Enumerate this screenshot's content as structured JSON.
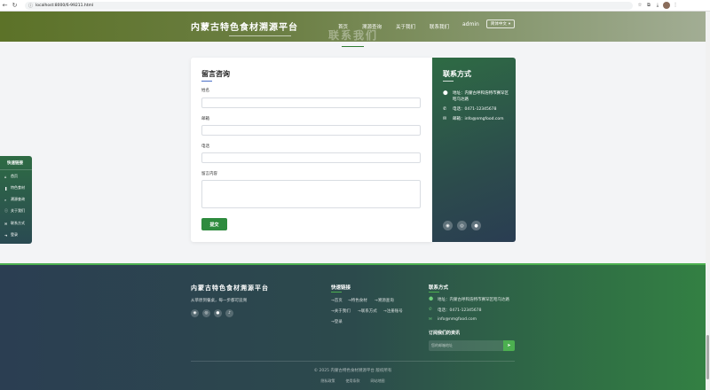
{
  "browser": {
    "url": "localhost:8000/6-99211.html",
    "back_icon": "←",
    "reload_icon": "↻",
    "info_icon": "ⓘ"
  },
  "header": {
    "brand": "内蒙古特色食材溯源平台",
    "ghost_title": "联系我们",
    "nav": [
      {
        "label": "首页"
      },
      {
        "label": "溯源查询"
      },
      {
        "label": "关于我们"
      },
      {
        "label": "联系我们"
      }
    ],
    "admin": "admin",
    "language": "简体中文"
  },
  "form": {
    "title": "留言咨询",
    "name_label": "姓名",
    "email_label": "邮箱",
    "phone_label": "电话",
    "message_label": "留言内容",
    "submit_label": "提交"
  },
  "contact": {
    "title": "联系方式",
    "address": "地址：内蒙古呼和浩特市赛罕区昭乌达路",
    "phone": "电话：0471-12345678",
    "email": "邮箱：info@nmgfood.com"
  },
  "side_links": {
    "title": "快速链接",
    "items": [
      {
        "label": "首页",
        "icon": "⌂"
      },
      {
        "label": "特色食材",
        "icon": "❚"
      },
      {
        "label": "溯源查询",
        "icon": "⌕"
      },
      {
        "label": "关于我们",
        "icon": "ⓘ"
      },
      {
        "label": "联系方式",
        "icon": "✉"
      },
      {
        "label": "登录",
        "icon": "➜"
      }
    ]
  },
  "footer": {
    "brand": "内蒙古特色食材溯源平台",
    "slogan": "从草原到餐桌，每一步都可追溯",
    "quick_title": "快速链接",
    "quick_links": [
      "→首页",
      "→特色食材",
      "→溯源查询",
      "→关于我们",
      "→联系方式",
      "→注册账号",
      "→登录"
    ],
    "contact_title": "联系方式",
    "address": "地址：内蒙古呼和浩特市赛罕区昭乌达路",
    "phone": "电话：0471-12345678",
    "email": "info@nmgfood.com",
    "subscribe_title": "订阅我们的资讯",
    "subscribe_placeholder": "您的邮箱地址",
    "copyright": "© 2025 内蒙古特色食材溯源平台 版权所有",
    "bottom_links": [
      "隐私政策",
      "使用条款",
      "网站地图"
    ]
  }
}
